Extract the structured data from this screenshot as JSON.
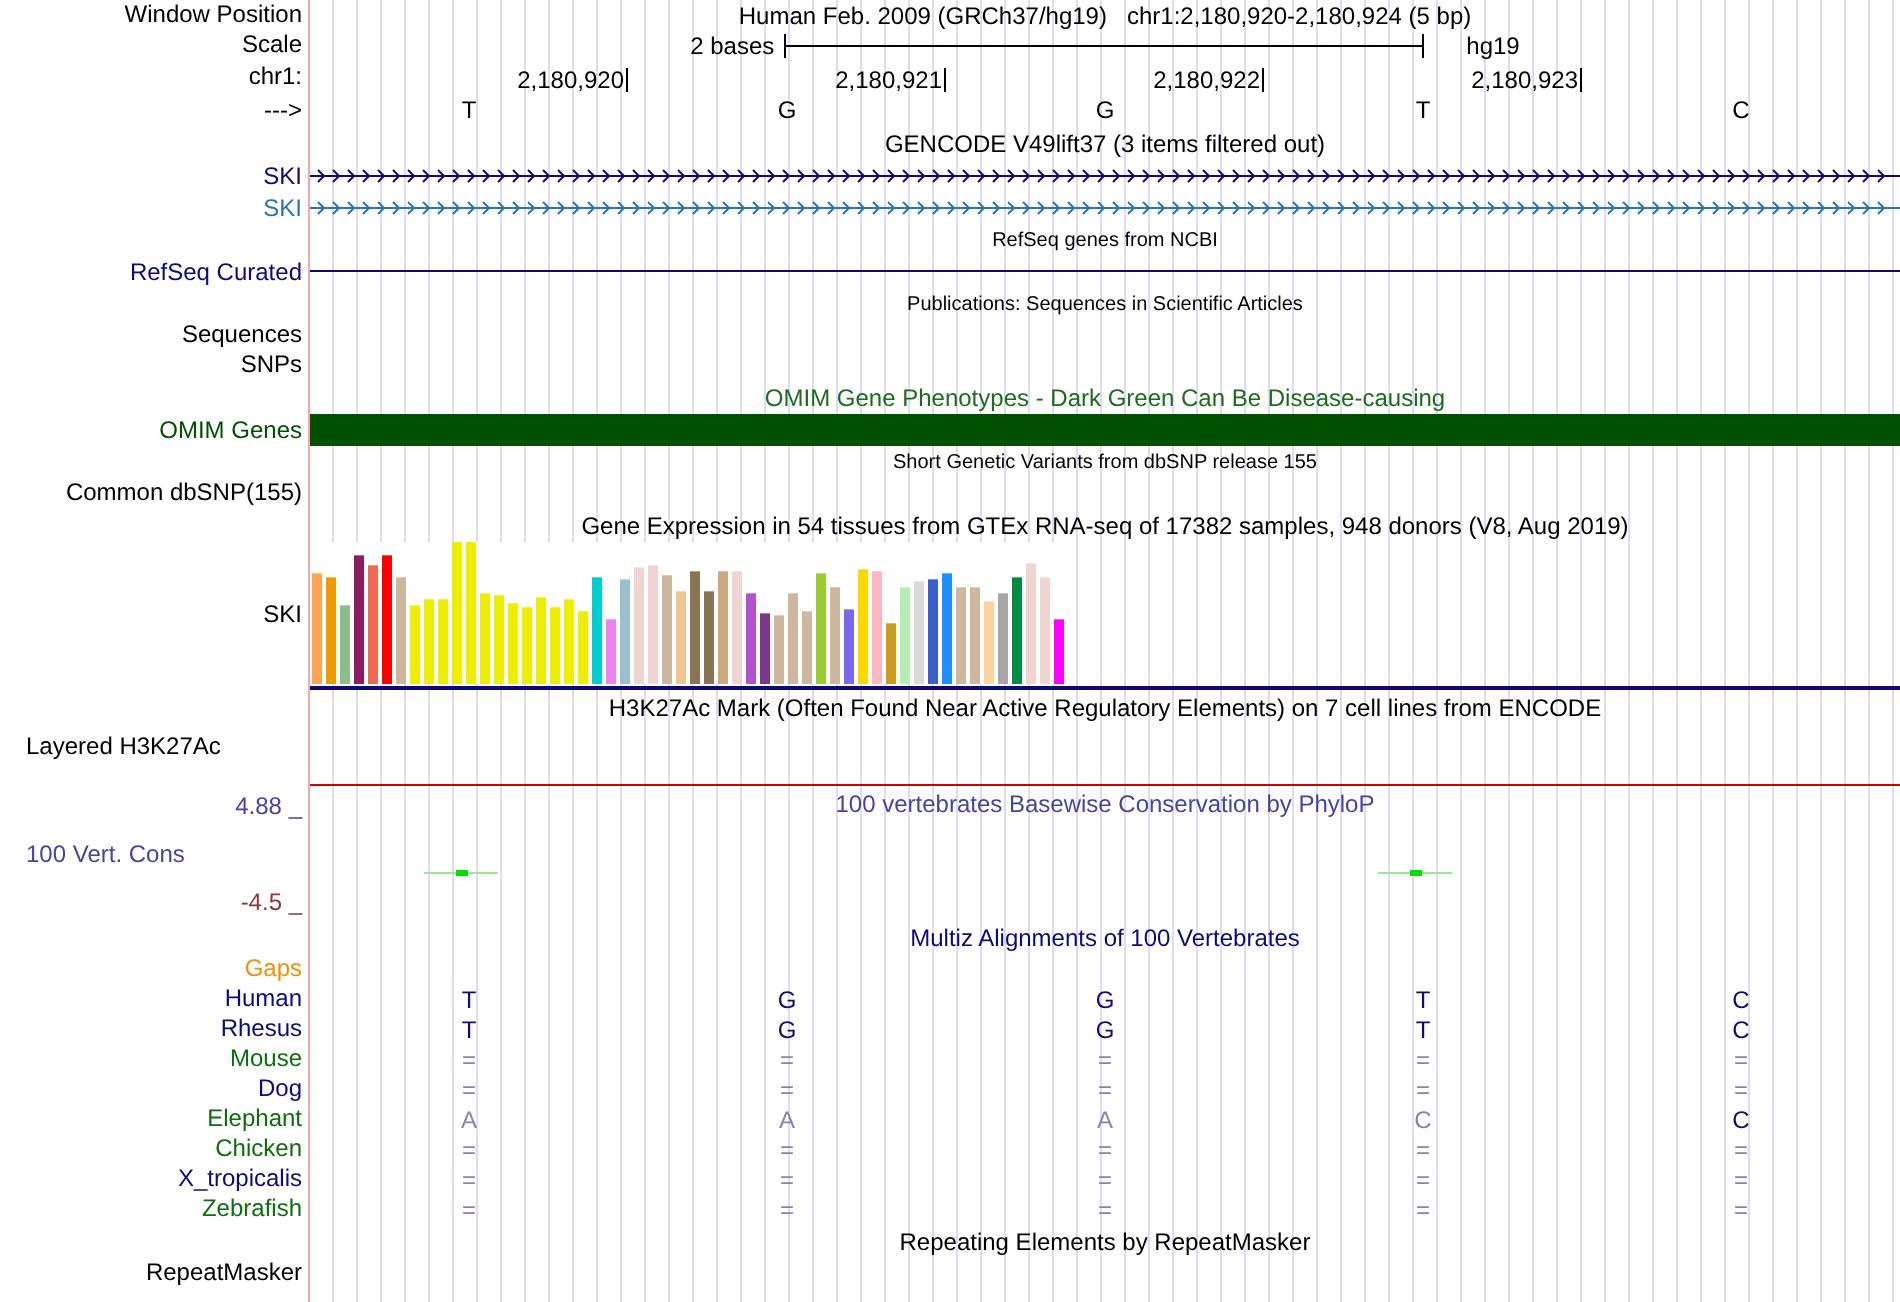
{
  "header": {
    "label": "Window Position",
    "assembly": "Human Feb. 2009 (GRCh37/hg19)",
    "position": "chr1:2,180,920-2,180,924 (5 bp)"
  },
  "scale": {
    "label": "Scale",
    "length": "2 bases",
    "assembly": "hg19"
  },
  "ruler": {
    "label": "chr1:",
    "ticks": [
      "2,180,920",
      "2,180,921",
      "2,180,922",
      "2,180,923"
    ]
  },
  "sequence": {
    "label": "--->",
    "bases": [
      "T",
      "G",
      "G",
      "T",
      "C"
    ]
  },
  "tracks": [
    {
      "kind": "title",
      "text": "GENCODE V49lift37 (3 items filtered out)",
      "color": "#000000"
    },
    {
      "kind": "gene",
      "label": "SKI",
      "color": "#0c0c78"
    },
    {
      "kind": "gene",
      "label": "SKI",
      "color": "#2a74b0"
    },
    {
      "kind": "small_title",
      "text": "RefSeq genes from NCBI",
      "color": "#000000"
    },
    {
      "kind": "line",
      "label": "RefSeq Curated",
      "color": "#0c0c78"
    },
    {
      "kind": "small_title",
      "text": "Publications: Sequences in Scientific Articles",
      "color": "#000000"
    },
    {
      "kind": "label",
      "label": "Sequences",
      "color": "#000000"
    },
    {
      "kind": "label",
      "label": "SNPs",
      "color": "#000000"
    },
    {
      "kind": "title",
      "text": "OMIM Gene Phenotypes - Dark Green Can Be Disease-causing",
      "color": "#1e6b1e"
    },
    {
      "kind": "bar",
      "label": "OMIM Genes",
      "color": "#005000"
    },
    {
      "kind": "small_title",
      "text": "Short Genetic Variants from dbSNP release 155",
      "color": "#000000"
    },
    {
      "kind": "label",
      "label": "Common dbSNP(155)",
      "color": "#000000"
    },
    {
      "kind": "title",
      "text": "Gene Expression in 54 tissues from GTEx RNA-seq of 17382 samples, 948 donors (V8, Aug 2019)",
      "color": "#000000"
    },
    {
      "kind": "expression",
      "label": "SKI",
      "color": "#000000"
    },
    {
      "kind": "title",
      "text": "H3K27Ac Mark (Often Found Near Active Regulatory Elements) on 7 cell lines from ENCODE",
      "color": "#000000"
    },
    {
      "kind": "layered",
      "label": "Layered H3K27Ac",
      "color": "#000000"
    },
    {
      "kind": "conservation",
      "title": "100 vertebrates Basewise Conservation by PhyloP",
      "label": "100 Vert. Cons",
      "max": "4.88 _",
      "min": "-4.5 _",
      "color": "#4545a0"
    },
    {
      "kind": "title",
      "text": "Multiz Alignments of 100 Vertebrates",
      "color": "#0c0c78"
    },
    {
      "kind": "label",
      "label": "Gaps",
      "color": "#f0900a"
    },
    {
      "kind": "species",
      "label": "Human",
      "color": "#0c0c78",
      "bases": [
        {
          "text": "T",
          "strong": true
        },
        {
          "text": "G",
          "strong": true
        },
        {
          "text": "G",
          "strong": true
        },
        {
          "text": "T",
          "strong": true
        },
        {
          "text": "C",
          "strong": true
        }
      ]
    },
    {
      "kind": "species",
      "label": "Rhesus",
      "color": "#0c0c78",
      "bases": [
        {
          "text": "T",
          "strong": true
        },
        {
          "text": "G",
          "strong": true
        },
        {
          "text": "G",
          "strong": true
        },
        {
          "text": "T",
          "strong": true
        },
        {
          "text": "C",
          "strong": true
        }
      ]
    },
    {
      "kind": "species",
      "label": "Mouse",
      "color": "#0e6e0e",
      "bases": [
        {
          "text": "=",
          "strong": false
        },
        {
          "text": "=",
          "strong": false
        },
        {
          "text": "=",
          "strong": false
        },
        {
          "text": "=",
          "strong": false
        },
        {
          "text": "=",
          "strong": false
        }
      ]
    },
    {
      "kind": "species",
      "label": "Dog",
      "color": "#0c0c78",
      "bases": [
        {
          "text": "=",
          "strong": false
        },
        {
          "text": "=",
          "strong": false
        },
        {
          "text": "=",
          "strong": false
        },
        {
          "text": "=",
          "strong": false
        },
        {
          "text": "=",
          "strong": false
        }
      ]
    },
    {
      "kind": "species",
      "label": "Elephant",
      "color": "#0e6e0e",
      "bases": [
        {
          "text": "A",
          "strong": false
        },
        {
          "text": "A",
          "strong": false
        },
        {
          "text": "A",
          "strong": false
        },
        {
          "text": "C",
          "strong": false
        },
        {
          "text": "C",
          "strong": true
        }
      ]
    },
    {
      "kind": "species",
      "label": "Chicken",
      "color": "#0e6e0e",
      "bases": [
        {
          "text": "=",
          "strong": false
        },
        {
          "text": "=",
          "strong": false
        },
        {
          "text": "=",
          "strong": false
        },
        {
          "text": "=",
          "strong": false
        },
        {
          "text": "=",
          "strong": false
        }
      ]
    },
    {
      "kind": "species",
      "label": "X_tropicalis",
      "color": "#0c0c78",
      "bases": [
        {
          "text": "=",
          "strong": false
        },
        {
          "text": "=",
          "strong": false
        },
        {
          "text": "=",
          "strong": false
        },
        {
          "text": "=",
          "strong": false
        },
        {
          "text": "=",
          "strong": false
        }
      ]
    },
    {
      "kind": "species",
      "label": "Zebrafish",
      "color": "#0e6e0e",
      "bases": [
        {
          "text": "=",
          "strong": false
        },
        {
          "text": "=",
          "strong": false
        },
        {
          "text": "=",
          "strong": false
        },
        {
          "text": "=",
          "strong": false
        },
        {
          "text": "=",
          "strong": false
        }
      ]
    },
    {
      "kind": "title",
      "text": "Repeating Elements by RepeatMasker",
      "color": "#000000"
    },
    {
      "kind": "label",
      "label": "RepeatMasker",
      "color": "#000000"
    }
  ]
}
